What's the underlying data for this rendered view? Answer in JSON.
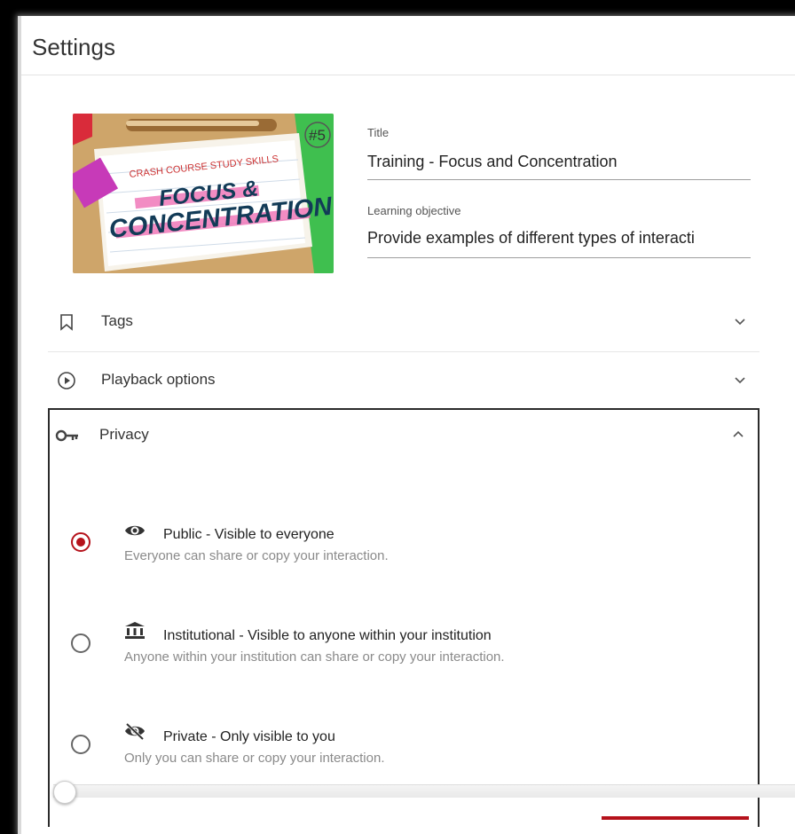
{
  "header": {
    "title": "Settings"
  },
  "thumbnail": {
    "badge": "#5",
    "series": "CRASH COURSE STUDY SKILLS",
    "line1": "FOCUS &",
    "line2": "CONCENTRATION"
  },
  "fields": {
    "title_label": "Title",
    "title_value": "Training - Focus and Concentration",
    "objective_label": "Learning objective",
    "objective_value": "Provide examples of different types of interacti"
  },
  "sections": {
    "tags": {
      "label": "Tags",
      "icon": "bookmark-icon"
    },
    "playback": {
      "label": "Playback options",
      "icon": "play-circle-icon"
    },
    "privacy": {
      "label": "Privacy",
      "icon": "key-icon"
    }
  },
  "privacy": {
    "options": [
      {
        "title": "Public - Visible to everyone",
        "desc": "Everyone can share or copy your interaction.",
        "checked": true,
        "icon": "eye-icon"
      },
      {
        "title": "Institutional - Visible to anyone within your institution",
        "desc": "Anyone within your institution can share or copy your interaction.",
        "checked": false,
        "icon": "institution-icon"
      },
      {
        "title": "Private - Only visible to you",
        "desc": "Only you can share or copy your interaction.",
        "checked": false,
        "icon": "eye-off-icon"
      }
    ]
  },
  "colors": {
    "accent": "#b5121b",
    "divider": "#e6e6e6"
  }
}
